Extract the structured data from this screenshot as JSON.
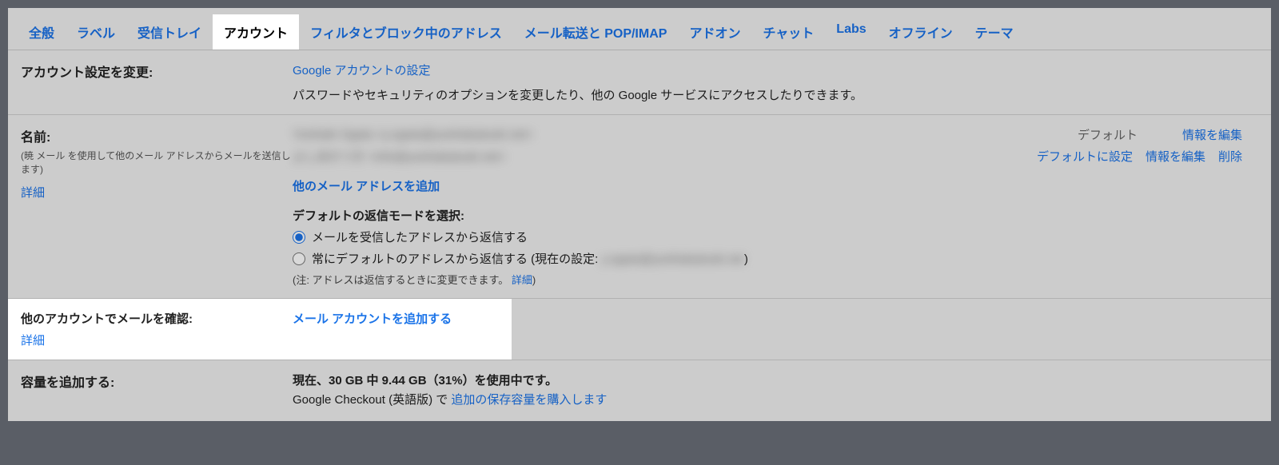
{
  "tabs": [
    {
      "label": "全般"
    },
    {
      "label": "ラベル"
    },
    {
      "label": "受信トレイ"
    },
    {
      "label": "アカウント",
      "active": true
    },
    {
      "label": "フィルタとブロック中のアドレス"
    },
    {
      "label": "メール転送と POP/IMAP"
    },
    {
      "label": "アドオン"
    },
    {
      "label": "チャット"
    },
    {
      "label": "Labs"
    },
    {
      "label": "オフライン"
    },
    {
      "label": "テーマ"
    }
  ],
  "changeAccount": {
    "title": "アカウント設定を変更:",
    "link": "Google アカウントの設定",
    "desc": "パスワードやセキュリティのオプションを変更したり、他の Google サービスにアクセスしたりできます。"
  },
  "name": {
    "title": "名前:",
    "subtitle": "(暁 メール を使用して他のメール アドレスからメールを送信します)",
    "details": "詳細",
    "row1_blurred": "Yoshiaki Ogata <y.ogata@yoshiakatsuki.net>",
    "row1_default": "デフォルト",
    "row1_edit": "情報を編集",
    "row2_blurred": "よしあかつき <info@yoshiakatsuki.net>",
    "row2_setDefault": "デフォルトに設定",
    "row2_edit": "情報を編集",
    "row2_delete": "削除",
    "addAddress": "他のメール アドレスを追加",
    "replyModeTitle": "デフォルトの返信モードを選択:",
    "radio1": "メールを受信したアドレスから返信する",
    "radio2_prefix": "常にデフォルトのアドレスから返信する (現在の設定: ",
    "radio2_blurred": "y.ogata@yoshiakatsuki.net",
    "radio2_suffix": ")",
    "note_prefix": "(注: アドレスは返信するときに変更できます。 ",
    "note_link": "詳細",
    "note_suffix": ")"
  },
  "checkMail": {
    "title": "他のアカウントでメールを確認:",
    "details": "詳細",
    "addAccount": "メール アカウントを追加する"
  },
  "storage": {
    "title": "容量を追加する:",
    "line1": "現在、30 GB 中 9.44 GB（31%）を使用中です。",
    "line2_prefix": "Google Checkout (英語版) で ",
    "line2_link": "追加の保存容量を購入します"
  }
}
